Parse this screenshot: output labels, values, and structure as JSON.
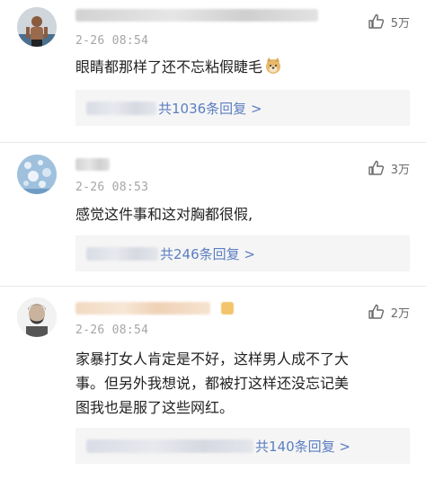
{
  "comments": [
    {
      "time": "2-26 08:54",
      "likes": "5万",
      "text": "眼睛都那样了还不忘粘假睫毛",
      "emoji": "doge-icon",
      "replies": "共1036条回复 >"
    },
    {
      "time": "2-26 08:53",
      "likes": "3万",
      "text": "感觉这件事和这对胸都很假,",
      "replies": "共246条回复 >"
    },
    {
      "time": "2-26 08:54",
      "likes": "2万",
      "text_lines": [
        "家暴打女人肯定是不好，这样男人成不了大",
        "事。但另外我想说，都被打这样还没忘记美",
        "图我也是服了这些网红。"
      ],
      "replies": "共140条回复 >"
    }
  ]
}
